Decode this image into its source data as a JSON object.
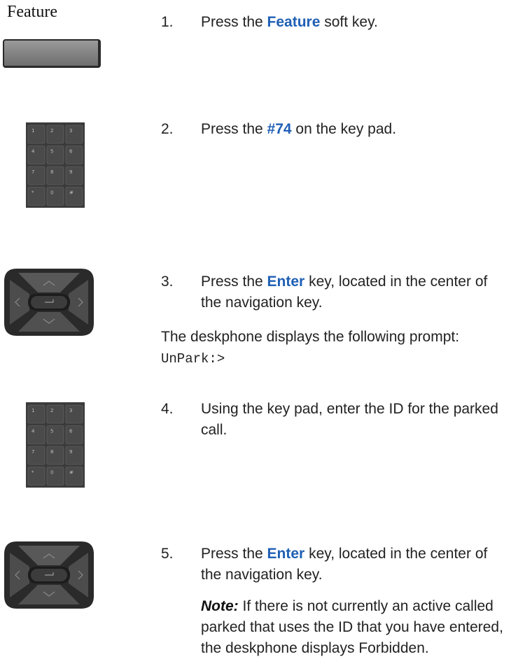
{
  "softkey": {
    "label": "Feature"
  },
  "keypad": {
    "keys": [
      "1",
      "2",
      "3",
      "4",
      "5",
      "6",
      "7",
      "8",
      "9",
      "*",
      "0",
      "#"
    ]
  },
  "steps": [
    {
      "num": "1.",
      "before": "Press the ",
      "keyword": "Feature",
      "after": " soft key."
    },
    {
      "num": "2.",
      "before": "Press the ",
      "keyword": "#74",
      "after": " on the key pad."
    },
    {
      "num": "3.",
      "before": "Press the ",
      "keyword": "Enter",
      "after": " key, located in the center of the navigation key."
    },
    {
      "num": "4.",
      "text": "Using the key pad, enter the ID for the parked call."
    },
    {
      "num": "5.",
      "before": "Press the ",
      "keyword": "Enter",
      "after": " key, located in the center of the navigation key."
    }
  ],
  "display_note": {
    "text": "The deskphone displays the following prompt: ",
    "prompt": "UnPark:>"
  },
  "note": {
    "label": "Note:",
    "text": " If there is not currently an active called parked that uses the ID that you have entered, the deskphone displays Forbidden."
  },
  "colors": {
    "keyword": "#1f5fb5",
    "keypad": "#4a4a4a",
    "navkey": "#3a3a3a"
  }
}
